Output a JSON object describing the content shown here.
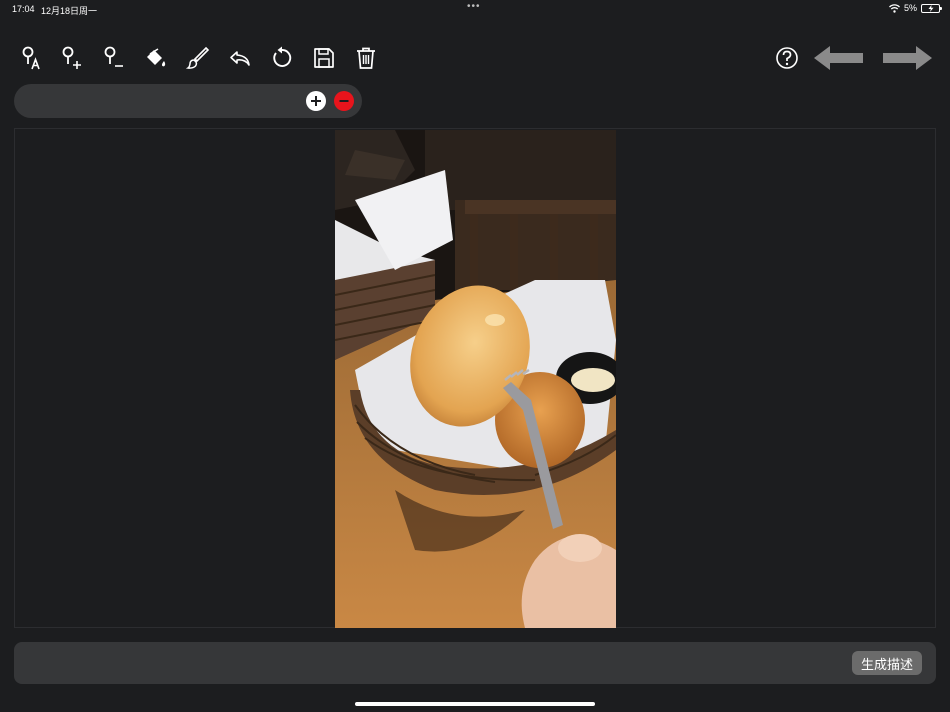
{
  "status_bar": {
    "time": "17:04",
    "date": "12月18日周一",
    "dots": "•••",
    "battery": "5%",
    "icons": [
      "wifi-icon",
      "battery-charging-icon"
    ]
  },
  "toolbar": {
    "icons": [
      "point-label-icon",
      "point-add-icon",
      "point-remove-icon",
      "paint-bucket-icon",
      "brush-icon",
      "undo-icon",
      "reset-icon",
      "save-icon",
      "trash-icon",
      "help-icon",
      "back-arrow-icon",
      "forward-arrow-icon"
    ]
  },
  "input_row": {
    "value": "",
    "placeholder": ""
  },
  "photo": {
    "subject": "bread-roll-on-fork-photo"
  },
  "bottom_bar": {
    "generate_label": "生成描述"
  },
  "colors": {
    "background": "#1c1d1f",
    "panel": "#363739",
    "accent_red": "#e8141c",
    "button_gray": "#6b6b6b",
    "arrow_gray": "#8a8a8a"
  }
}
